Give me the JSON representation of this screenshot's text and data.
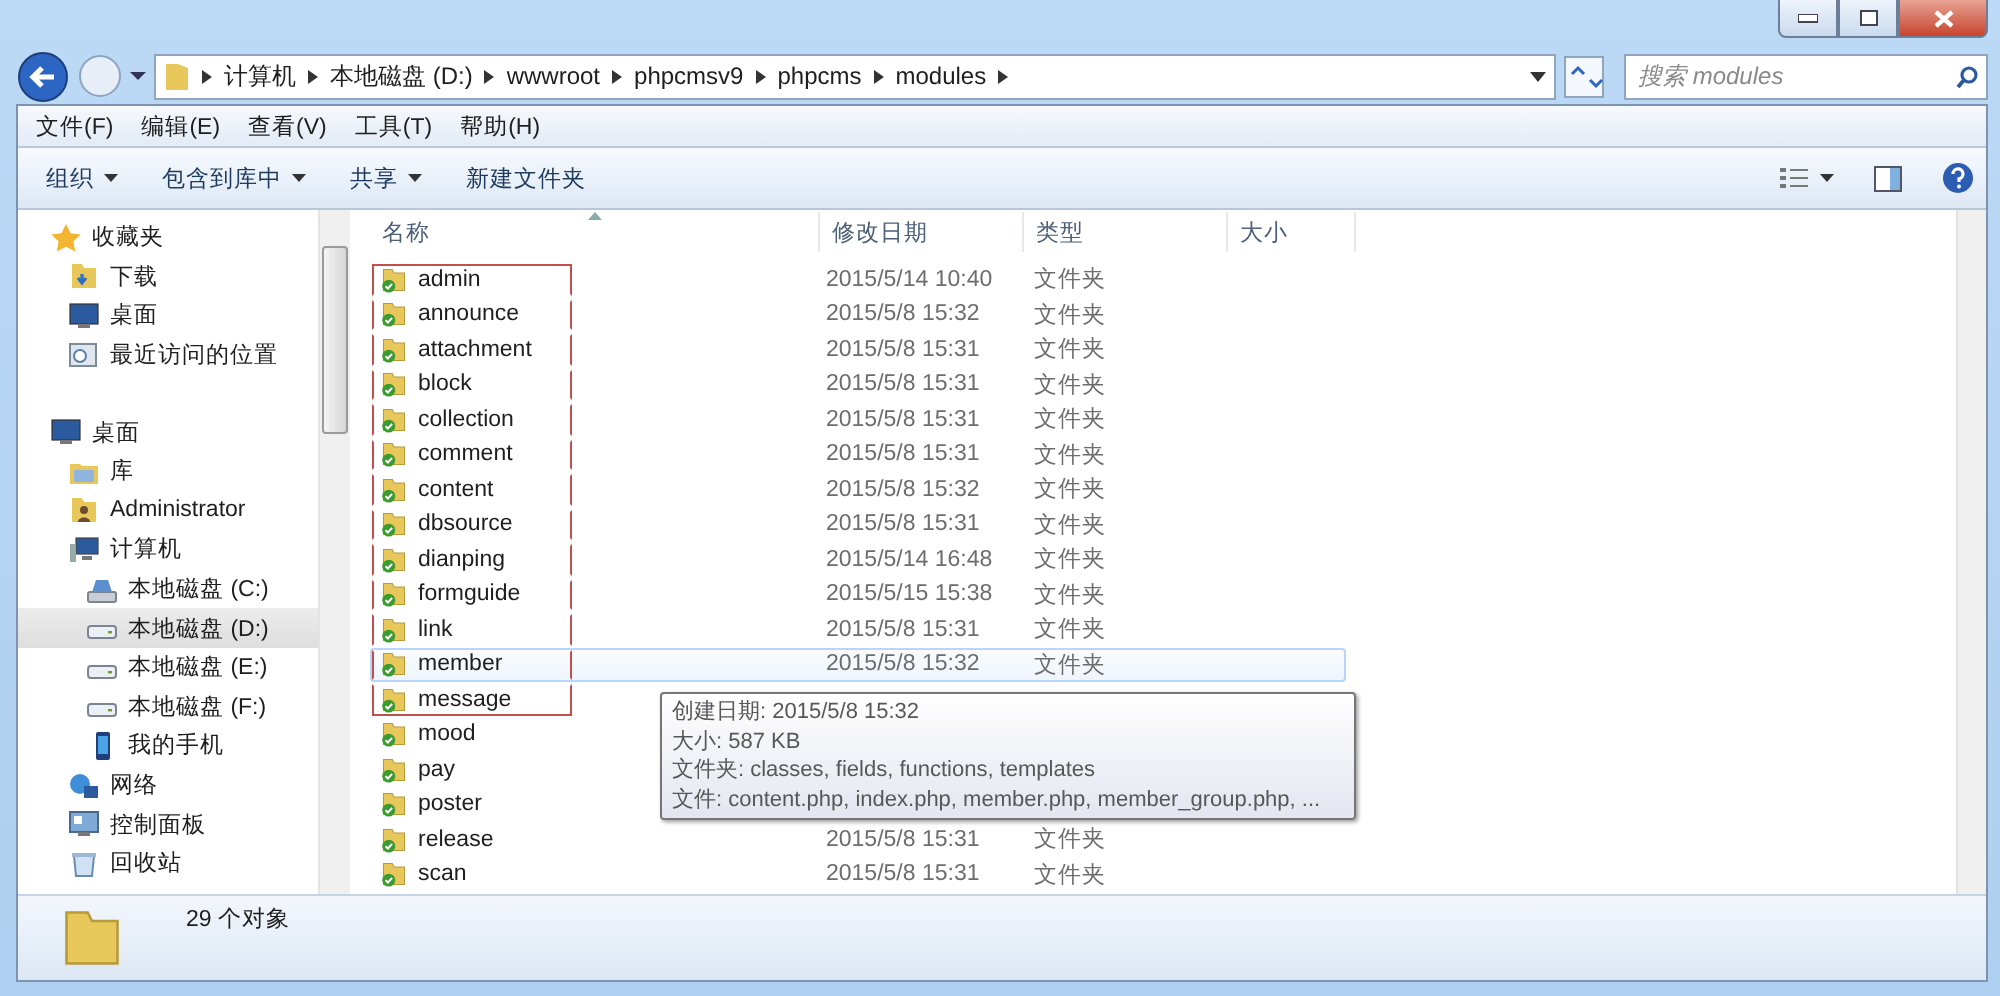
{
  "address": {
    "crumbs": [
      "计算机",
      "本地磁盘 (D:)",
      "wwwroot",
      "phpcmsv9",
      "phpcms",
      "modules"
    ]
  },
  "search": {
    "placeholder": "搜索 modules"
  },
  "menu": [
    "文件(F)",
    "编辑(E)",
    "查看(V)",
    "工具(T)",
    "帮助(H)"
  ],
  "toolbar": [
    {
      "label": "组织",
      "has_menu": true
    },
    {
      "label": "包含到库中",
      "has_menu": true
    },
    {
      "label": "共享",
      "has_menu": true
    },
    {
      "label": "新建文件夹",
      "has_menu": false
    }
  ],
  "sidebar": {
    "items": [
      {
        "label": "收藏夹",
        "kind": "star",
        "selected": false,
        "children": [
          {
            "label": "下载",
            "kind": "download",
            "selected": false
          },
          {
            "label": "桌面",
            "kind": "desktop",
            "selected": false
          },
          {
            "label": "最近访问的位置",
            "kind": "recent",
            "selected": false
          }
        ]
      },
      {
        "label": "桌面",
        "kind": "desktop",
        "selected": false,
        "children": [
          {
            "label": "库",
            "kind": "library",
            "selected": false
          },
          {
            "label": "Administrator",
            "kind": "user",
            "selected": false
          },
          {
            "label": "计算机",
            "kind": "computer",
            "selected": false,
            "children": [
              {
                "label": "本地磁盘 (C:)",
                "kind": "system-drive",
                "selected": false
              },
              {
                "label": "本地磁盘 (D:)",
                "kind": "drive",
                "selected": true
              },
              {
                "label": "本地磁盘 (E:)",
                "kind": "drive",
                "selected": false
              },
              {
                "label": "本地磁盘 (F:)",
                "kind": "drive",
                "selected": false
              },
              {
                "label": "我的手机",
                "kind": "phone",
                "selected": false
              }
            ]
          },
          {
            "label": "网络",
            "kind": "network",
            "selected": false
          },
          {
            "label": "控制面板",
            "kind": "control-panel",
            "selected": false
          },
          {
            "label": "回收站",
            "kind": "recycle",
            "selected": false
          }
        ]
      }
    ]
  },
  "table": {
    "columns": [
      {
        "label": "名称",
        "sorted": true
      },
      {
        "label": "修改日期",
        "sorted": false
      },
      {
        "label": "类型",
        "sorted": false
      },
      {
        "label": "大小",
        "sorted": false
      }
    ],
    "rows": [
      {
        "name": "admin",
        "date": "2015/5/14 10:40",
        "type": "文件夹",
        "marked": true,
        "hovered": false
      },
      {
        "name": "announce",
        "date": "2015/5/8 15:32",
        "type": "文件夹",
        "marked": true,
        "hovered": false
      },
      {
        "name": "attachment",
        "date": "2015/5/8 15:31",
        "type": "文件夹",
        "marked": true,
        "hovered": false
      },
      {
        "name": "block",
        "date": "2015/5/8 15:31",
        "type": "文件夹",
        "marked": true,
        "hovered": false
      },
      {
        "name": "collection",
        "date": "2015/5/8 15:31",
        "type": "文件夹",
        "marked": true,
        "hovered": false
      },
      {
        "name": "comment",
        "date": "2015/5/8 15:31",
        "type": "文件夹",
        "marked": true,
        "hovered": false
      },
      {
        "name": "content",
        "date": "2015/5/8 15:32",
        "type": "文件夹",
        "marked": true,
        "hovered": false
      },
      {
        "name": "dbsource",
        "date": "2015/5/8 15:31",
        "type": "文件夹",
        "marked": true,
        "hovered": false
      },
      {
        "name": "dianping",
        "date": "2015/5/14 16:48",
        "type": "文件夹",
        "marked": true,
        "hovered": false
      },
      {
        "name": "formguide",
        "date": "2015/5/15 15:38",
        "type": "文件夹",
        "marked": true,
        "hovered": false
      },
      {
        "name": "link",
        "date": "2015/5/8 15:31",
        "type": "文件夹",
        "marked": true,
        "hovered": false
      },
      {
        "name": "member",
        "date": "2015/5/8 15:32",
        "type": "文件夹",
        "marked": true,
        "hovered": true
      },
      {
        "name": "message",
        "marked": true,
        "hovered": false
      },
      {
        "name": "mood",
        "marked": false,
        "hovered": false
      },
      {
        "name": "pay",
        "marked": false,
        "hovered": false
      },
      {
        "name": "poster",
        "marked": false,
        "hovered": false
      },
      {
        "name": "release",
        "date": "2015/5/8 15:31",
        "type": "文件夹",
        "marked": false,
        "hovered": false
      },
      {
        "name": "scan",
        "date": "2015/5/8 15:31",
        "type": "文件夹",
        "marked": false,
        "hovered": false
      }
    ]
  },
  "tooltip": {
    "lines": [
      "创建日期: 2015/5/8 15:32",
      "大小: 587 KB",
      "文件夹: classes, fields, functions, templates",
      "文件: content.php, index.php, member.php, member_group.php, ..."
    ]
  },
  "status_bar": {
    "count": "29 个对象"
  }
}
